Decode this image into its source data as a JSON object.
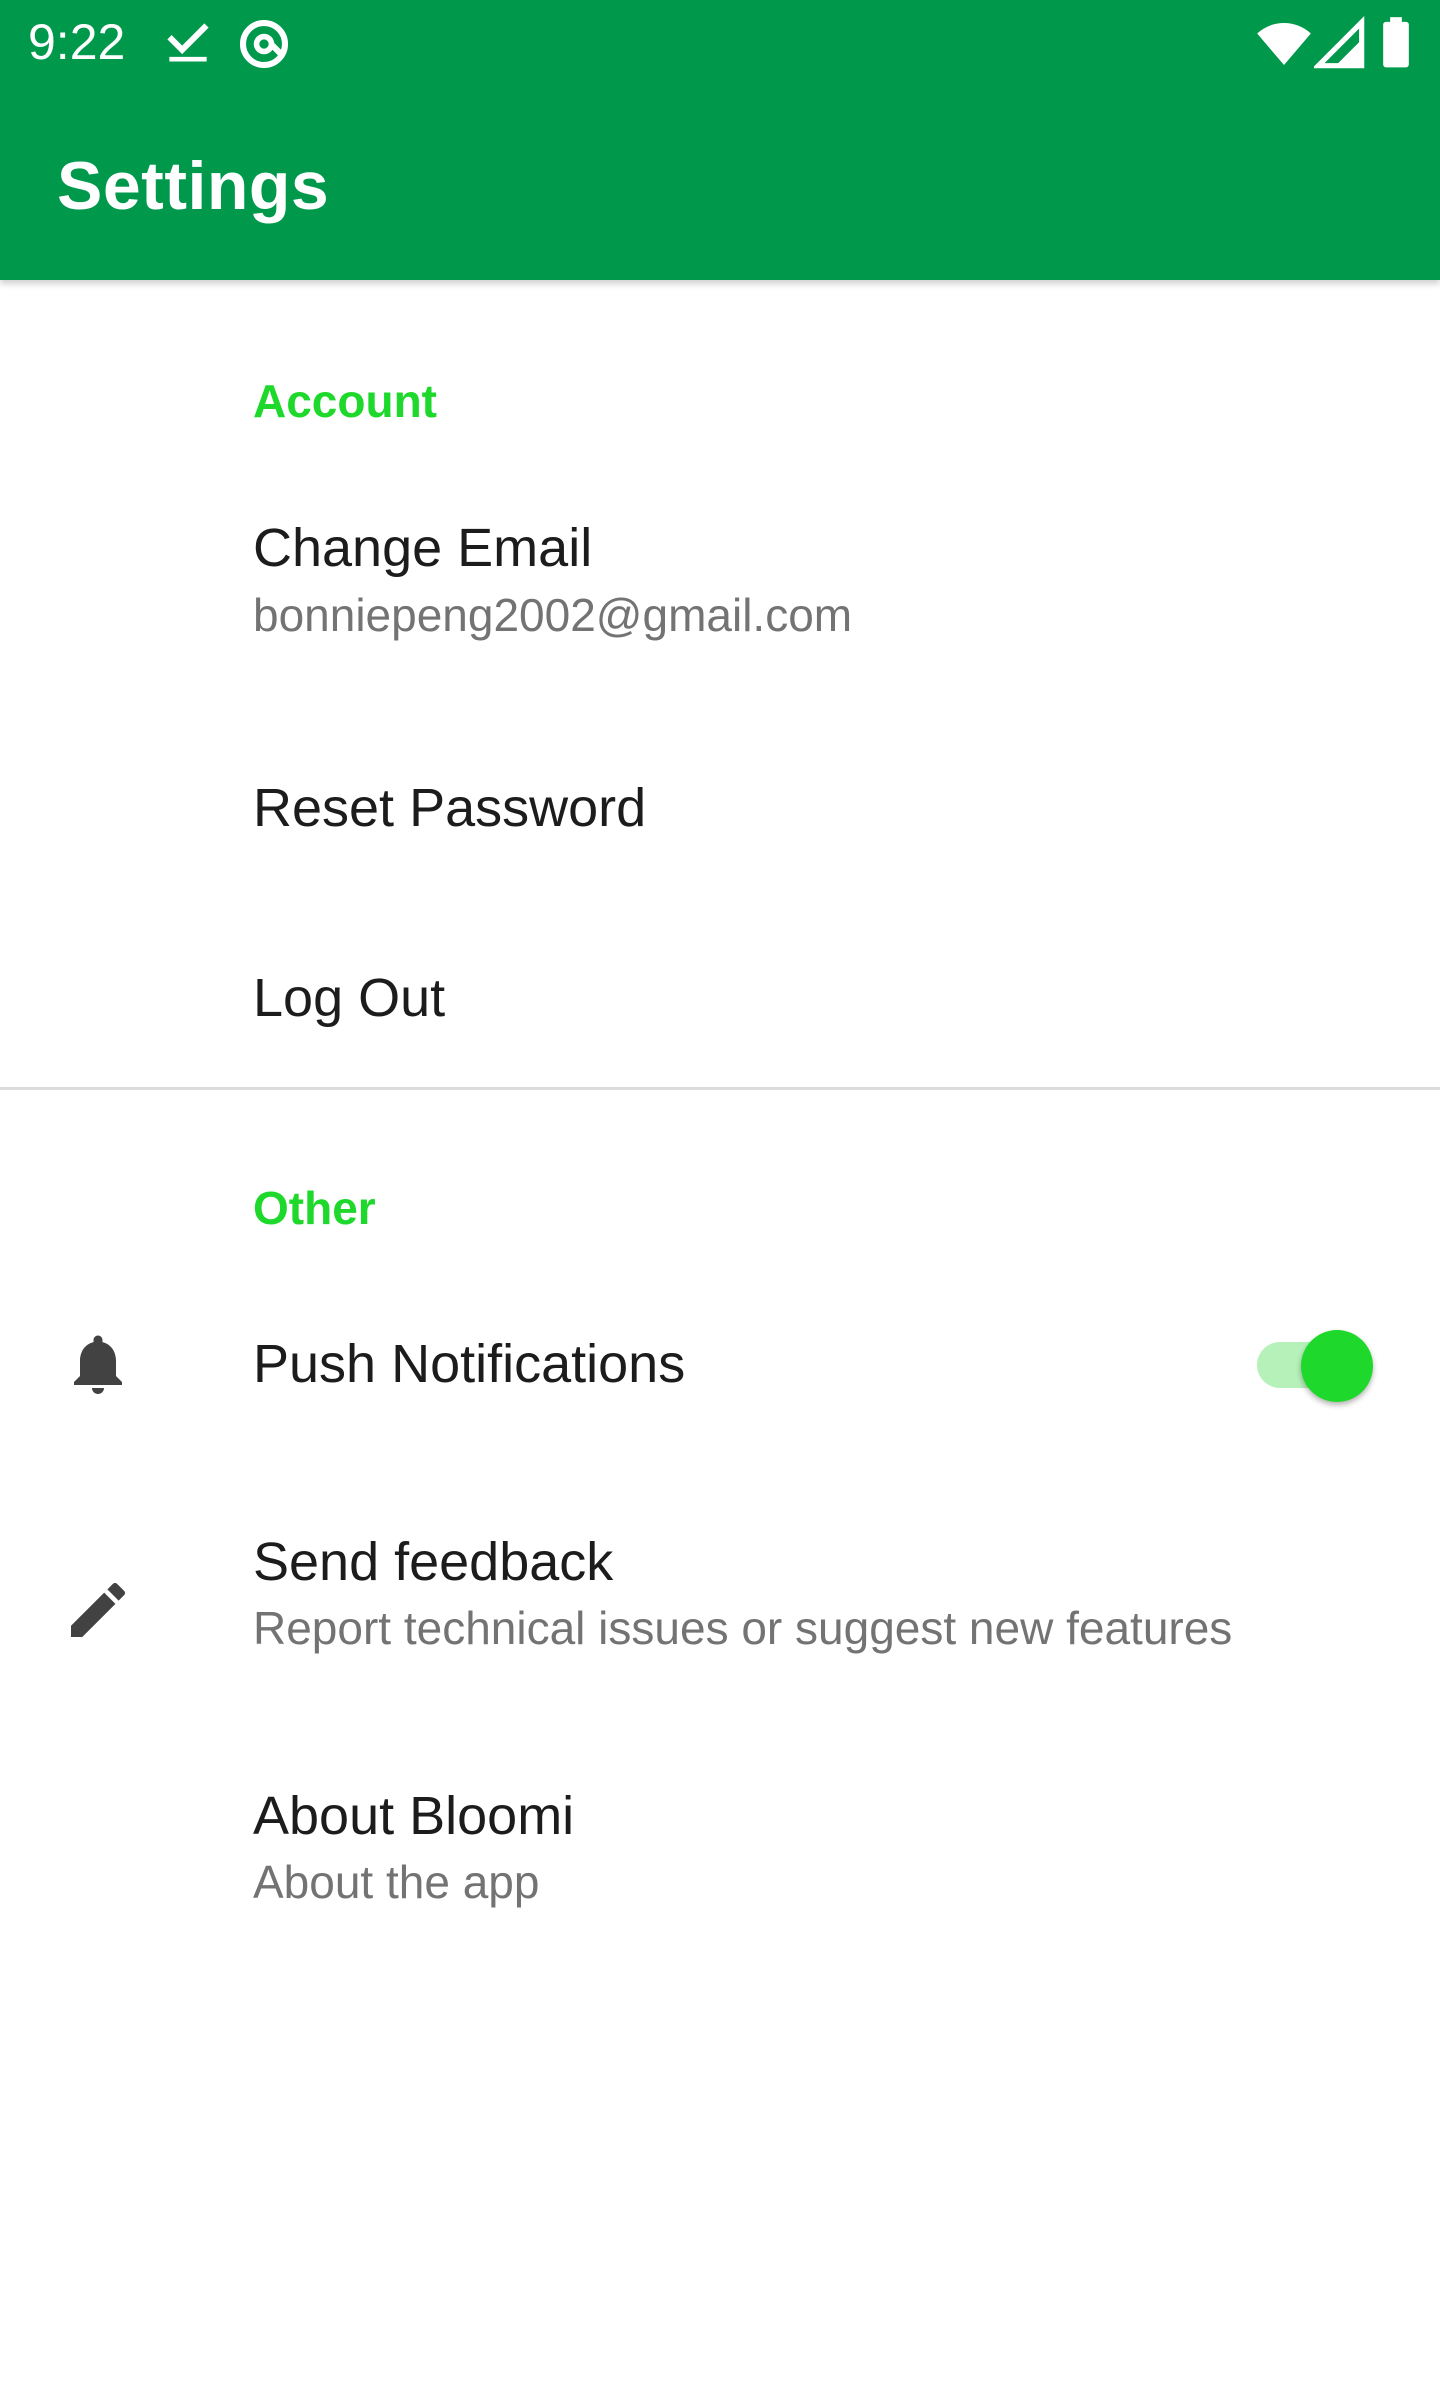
{
  "status_bar": {
    "time": "9:22",
    "icons": [
      "check-download-icon",
      "at-sign-icon",
      "wifi-icon",
      "cellular-signal-icon",
      "battery-icon"
    ]
  },
  "app_bar": {
    "title": "Settings"
  },
  "colors": {
    "app_bar": "#00994C",
    "accent": "#1ED92B",
    "switch_track": "#B6F1BA",
    "divider": "#DCDCDC"
  },
  "sections": {
    "account": {
      "header": "Account",
      "items": [
        {
          "title": "Change Email",
          "summary": "bonniepeng2002@gmail.com"
        },
        {
          "title": "Reset Password"
        },
        {
          "title": "Log Out"
        }
      ]
    },
    "other": {
      "header": "Other",
      "items": [
        {
          "title": "Push Notifications",
          "icon": "bell-icon",
          "switch_on": true
        },
        {
          "title": "Send feedback",
          "summary": "Report technical issues or suggest new features",
          "icon": "pencil-icon"
        },
        {
          "title": "About Bloomi",
          "summary": "About the app"
        }
      ]
    }
  }
}
